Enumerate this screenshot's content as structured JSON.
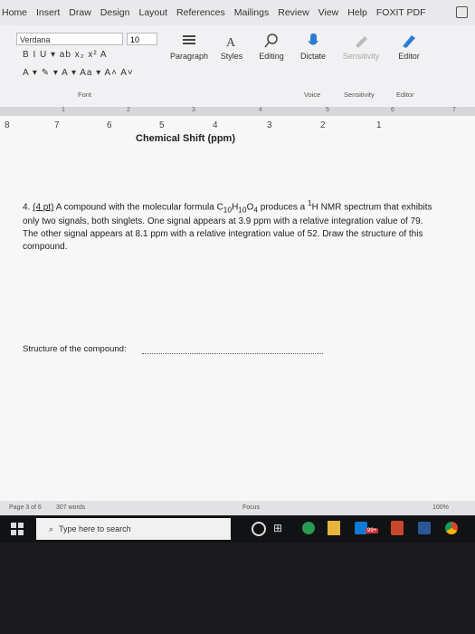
{
  "ribbon_tabs": [
    "Home",
    "Insert",
    "Draw",
    "Design",
    "Layout",
    "References",
    "Mailings",
    "Review",
    "View",
    "Help",
    "FOXIT PDF"
  ],
  "font": {
    "name": "Verdana",
    "size": "10"
  },
  "format_row1": "B  I  U  ▾  ab  x₂  x²  A",
  "format_row2": "A ▾  ✎ ▾  A ▾  Aa ▾  A˄  A˅",
  "buttons": {
    "paragraph": "Paragraph",
    "styles": "Styles",
    "editing": "Editing",
    "dictate": "Dictate",
    "sensitivity": "Sensitivity",
    "editor": "Editor"
  },
  "group_labels": {
    "font": "Font",
    "voice": "Voice",
    "sensitivity": "Sensitivity",
    "editor": "Editor"
  },
  "ruler_numbers": [
    "1",
    "2",
    "3",
    "4",
    "5",
    "6",
    "7"
  ],
  "axis_numbers": [
    "8",
    "7",
    "6",
    "5",
    "4",
    "3",
    "2",
    "1"
  ],
  "axis_title": "Chemical Shift (ppm)",
  "question": {
    "number": "4.",
    "points": "(4 pt)",
    "text_before": "A compound with the molecular formula C",
    "c_sub": "10",
    "h": "H",
    "h_sub": "10",
    "o": "O",
    "o_sub": "4",
    "text_mid": " produces a ",
    "h_sup": "1",
    "text_after": "H NMR spectrum that exhibits only two signals, both singlets. One signal appears at 3.9 ppm with a relative integration value of 79. The other signal appears at 8.1 ppm with a relative integration value of 52. Draw the structure of this compound."
  },
  "structure_label": "Structure of the compound:",
  "status": {
    "page": "Page 3 of 6",
    "words": "307 words",
    "focus": "Focus",
    "zoom": "100%"
  },
  "taskbar": {
    "search_placeholder": "Type here to search",
    "badge": "99+"
  }
}
